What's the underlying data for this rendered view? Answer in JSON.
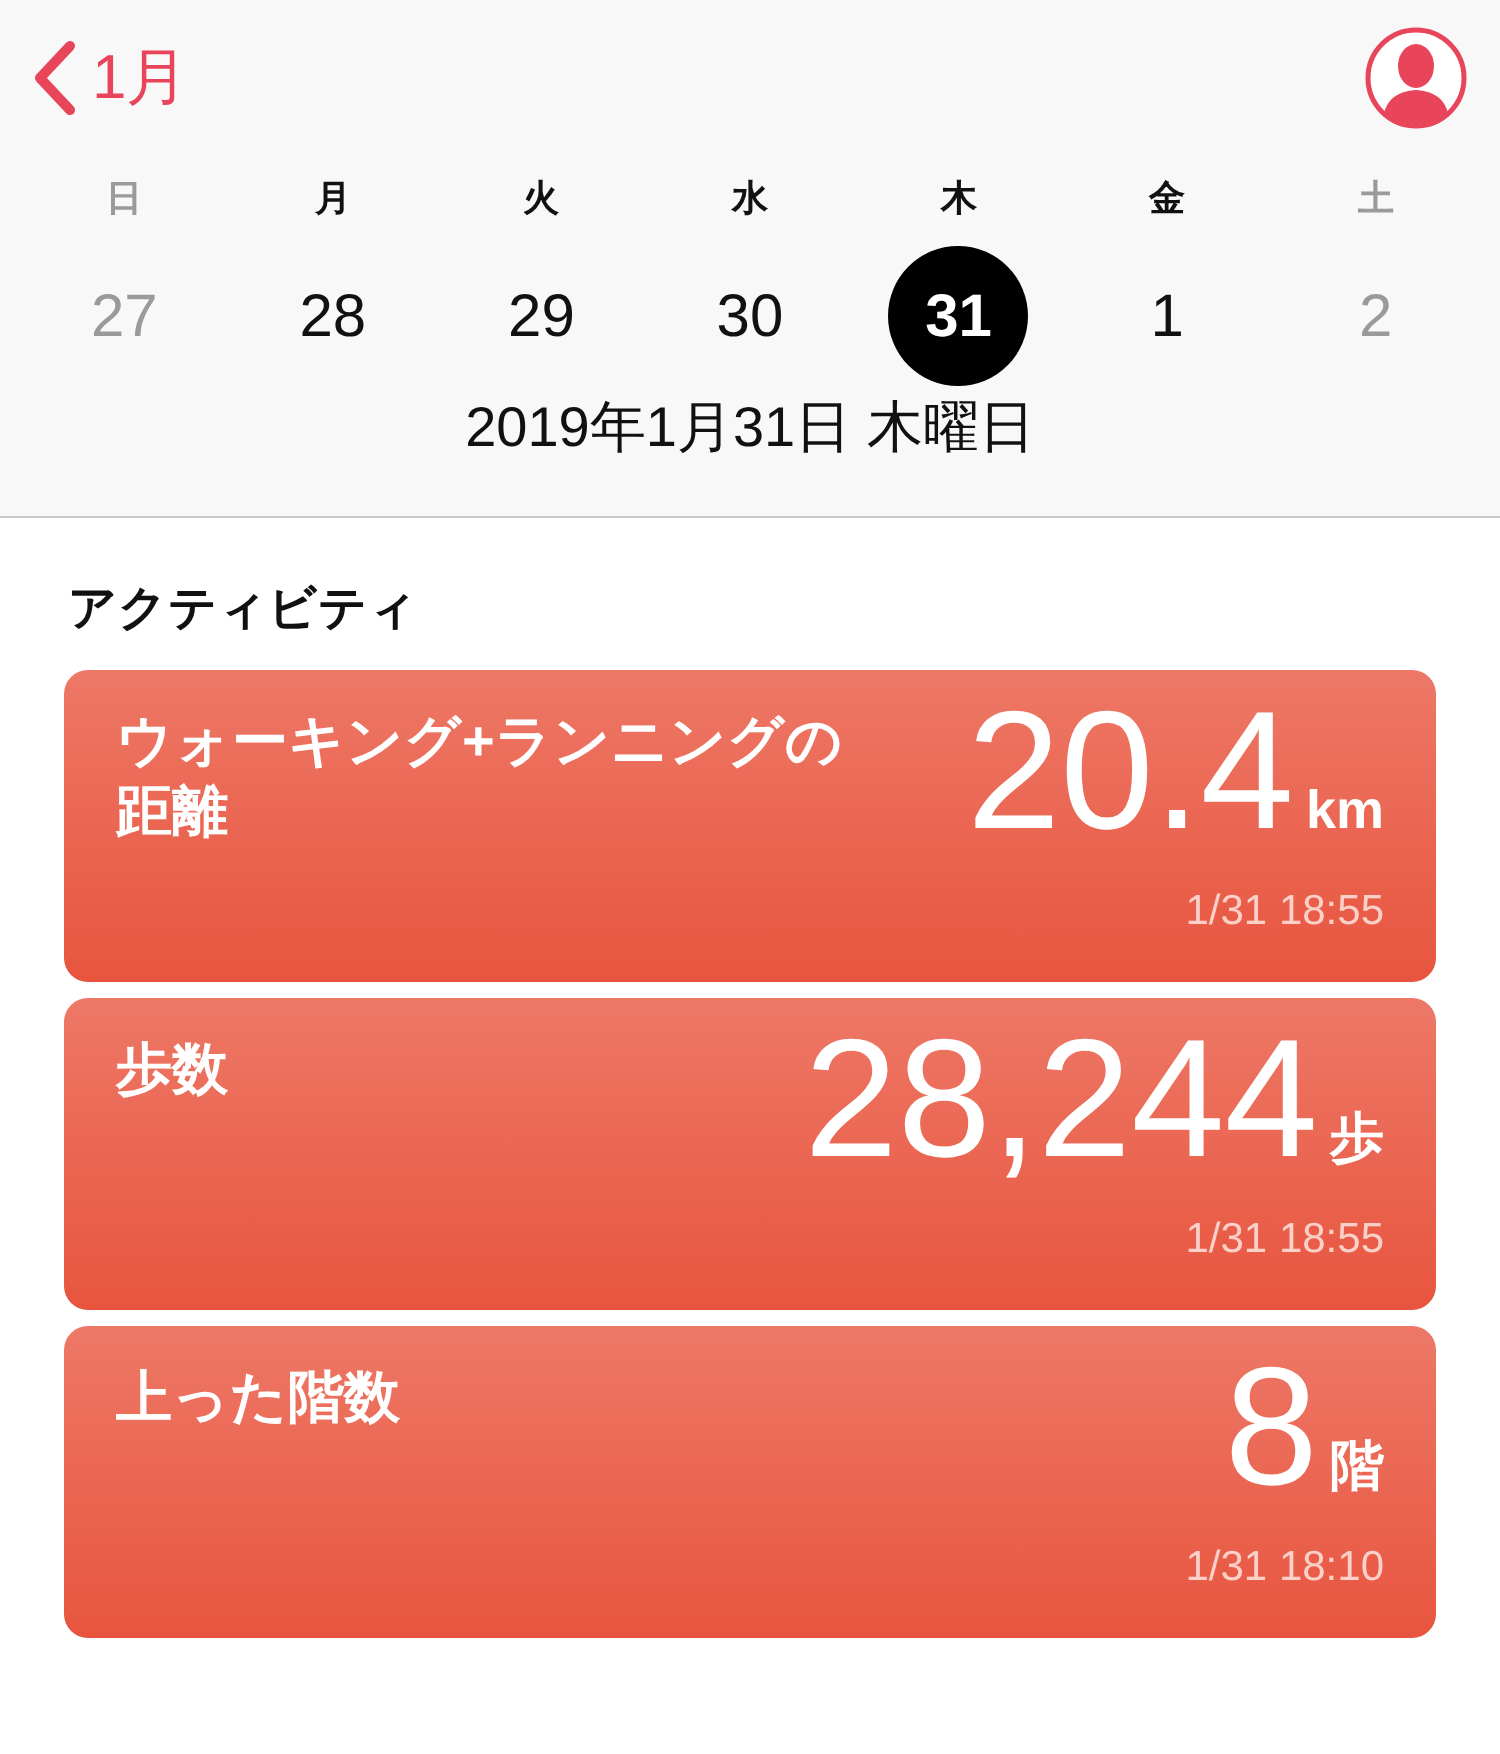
{
  "nav": {
    "back_label": "1月"
  },
  "week": [
    {
      "weekday": "日",
      "date": "27",
      "weekend": true,
      "selected": false
    },
    {
      "weekday": "月",
      "date": "28",
      "weekend": false,
      "selected": false
    },
    {
      "weekday": "火",
      "date": "29",
      "weekend": false,
      "selected": false
    },
    {
      "weekday": "水",
      "date": "30",
      "weekend": false,
      "selected": false
    },
    {
      "weekday": "木",
      "date": "31",
      "weekend": false,
      "selected": true
    },
    {
      "weekday": "金",
      "date": "1",
      "weekend": false,
      "selected": false
    },
    {
      "weekday": "土",
      "date": "2",
      "weekend": true,
      "selected": false
    }
  ],
  "selected_date": "2019年1月31日 木曜日",
  "section_title": "アクティビティ",
  "cards": [
    {
      "title": "ウォーキング+ランニングの距離",
      "value": "20.4",
      "unit": "km",
      "time": "1/31 18:55"
    },
    {
      "title": "歩数",
      "value": "28,244",
      "unit": "歩",
      "time": "1/31 18:55"
    },
    {
      "title": "上った階数",
      "value": "8",
      "unit": "階",
      "time": "1/31 18:10"
    }
  ]
}
